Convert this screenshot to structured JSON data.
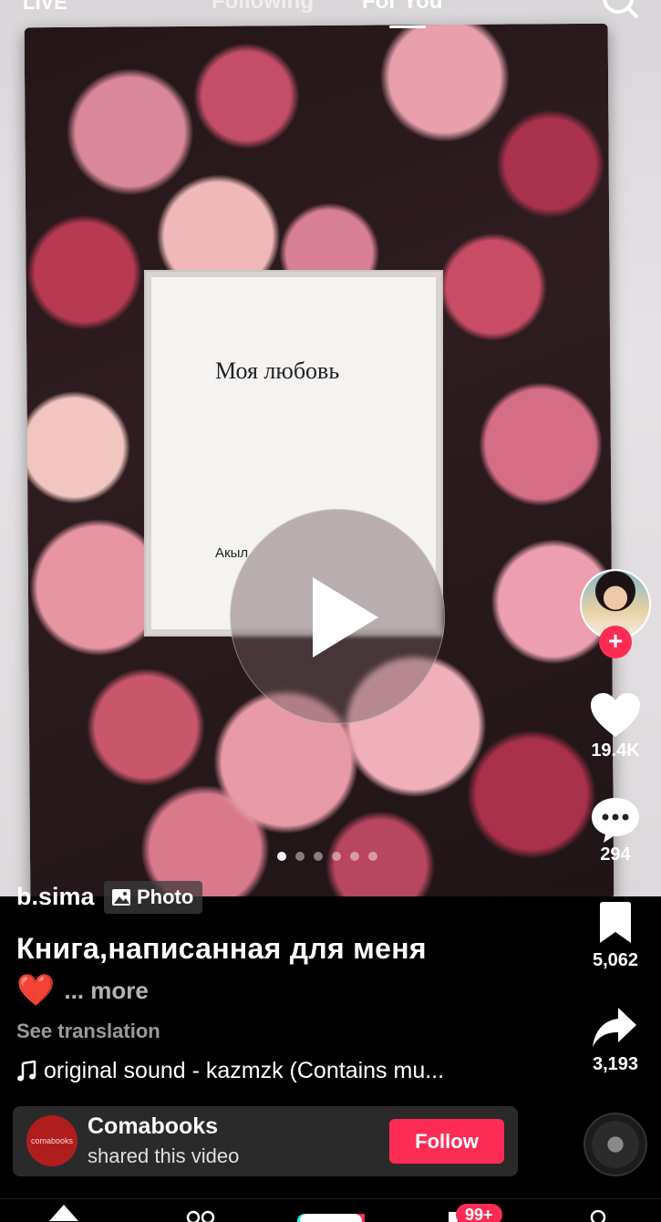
{
  "top_nav": {
    "live": "LIVE",
    "following": "Following",
    "for_you": "For You"
  },
  "post": {
    "book_title": "Моя любовь",
    "book_author": "Акыл",
    "carousel_count": 6,
    "carousel_active": 1,
    "username": "b.sima",
    "media_type": "Photo",
    "caption": "Книга,написанная для меня",
    "caption_emoji": "❤️",
    "more_label": "... more",
    "see_translation": "See translation",
    "sound": "original sound - kazmzk (Contains mu..."
  },
  "rail": {
    "likes": "19.4K",
    "comments": "294",
    "saves": "5,062",
    "shares": "3,193"
  },
  "shared_by": {
    "logo_text": "comabooks",
    "name": "Comabooks",
    "subtitle": "shared this video",
    "follow_label": "Follow"
  },
  "bottom_nav": {
    "inbox_badge": "99+"
  },
  "colors": {
    "accent": "#fe2c55",
    "background": "#000000"
  }
}
